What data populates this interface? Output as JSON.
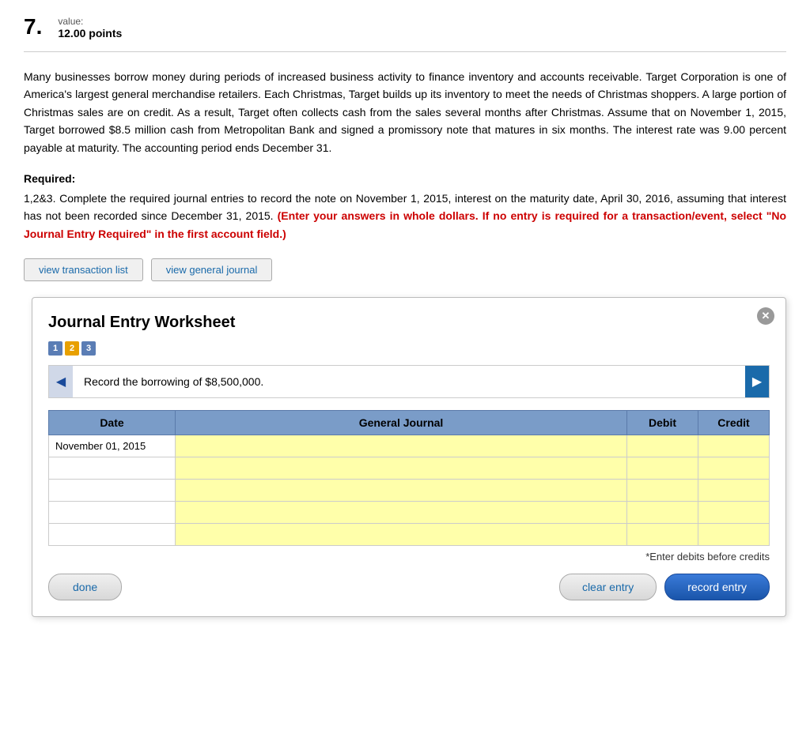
{
  "question": {
    "number": "7.",
    "value_label": "value:",
    "points": "12.00 points"
  },
  "passage": "Many businesses borrow money during periods of increased business activity to finance inventory and accounts receivable. Target Corporation is one of America's largest general merchandise retailers. Each Christmas, Target builds up its inventory to meet the needs of Christmas shoppers. A large portion of Christmas sales are on credit. As a result, Target often collects cash from the sales several months after Christmas. Assume that on November 1, 2015, Target borrowed $8.5 million cash from Metropolitan Bank and signed a promissory note that matures in six months. The interest rate was 9.00 percent payable at maturity. The accounting period ends December 31.",
  "required_label": "Required:",
  "instruction_text": "1,2&3. Complete the required journal entries to record the note on November 1, 2015, interest on the maturity date, April 30, 2016, assuming that interest has not been recorded since December 31, 2015.",
  "red_instruction": "(Enter your answers in whole dollars. If no entry is required for a transaction/event, select \"No Journal Entry Required\" in the first account field.)",
  "buttons": {
    "view_transaction_list": "view transaction list",
    "view_general_journal": "view general journal"
  },
  "worksheet": {
    "title": "Journal Entry Worksheet",
    "close_label": "X",
    "steps": [
      {
        "label": "1",
        "state": "active"
      },
      {
        "label": "2",
        "state": "current"
      },
      {
        "label": "3",
        "state": "active"
      }
    ],
    "slide_text": "Record the borrowing of $8,500,000.",
    "table": {
      "headers": [
        "Date",
        "General Journal",
        "Debit",
        "Credit"
      ],
      "rows": [
        {
          "date": "November 01, 2015",
          "gj": "",
          "debit": "",
          "credit": ""
        },
        {
          "date": "",
          "gj": "",
          "debit": "",
          "credit": ""
        },
        {
          "date": "",
          "gj": "",
          "debit": "",
          "credit": ""
        },
        {
          "date": "",
          "gj": "",
          "debit": "",
          "credit": ""
        },
        {
          "date": "",
          "gj": "",
          "debit": "",
          "credit": ""
        }
      ]
    },
    "debit_credit_note": "*Enter debits before credits",
    "buttons": {
      "done": "done",
      "clear_entry": "clear entry",
      "record_entry": "record entry"
    }
  }
}
